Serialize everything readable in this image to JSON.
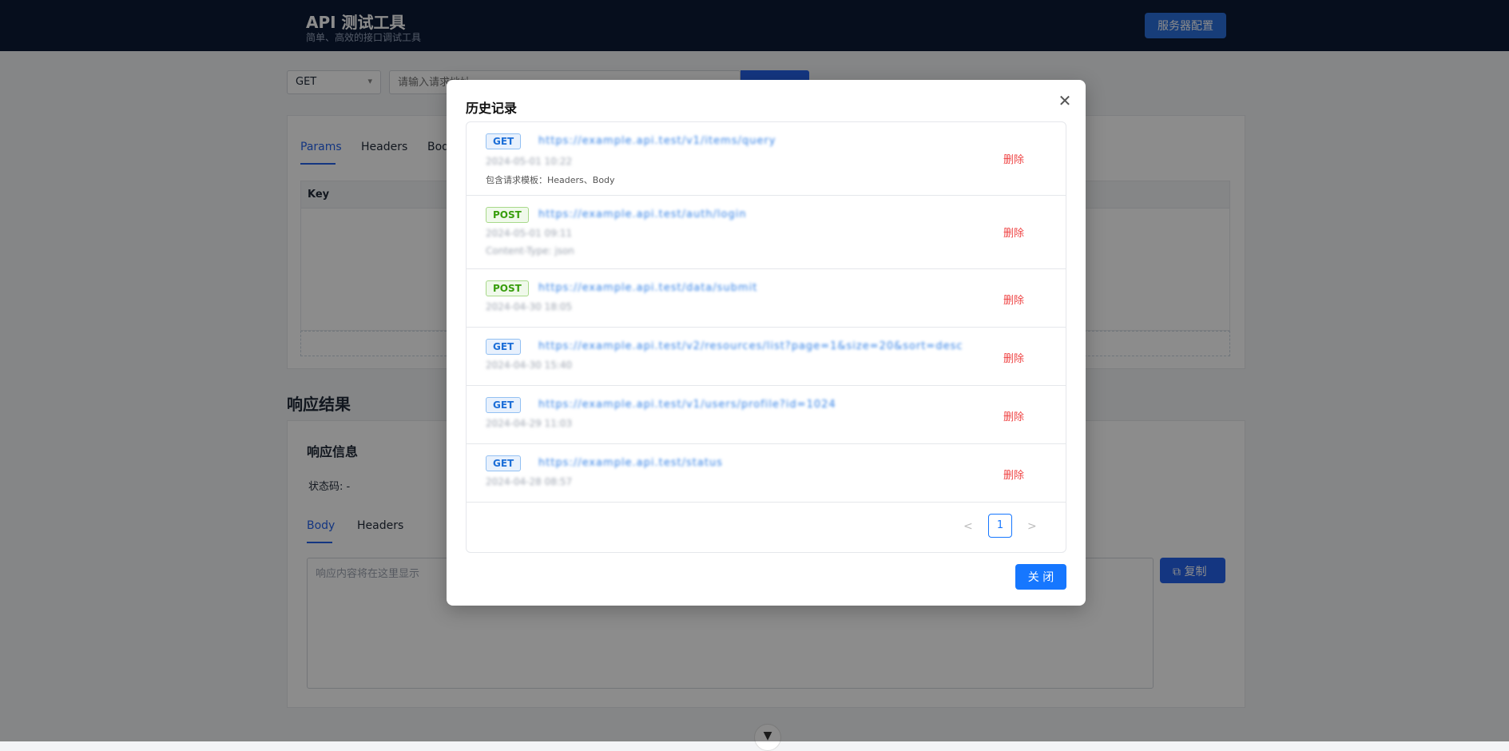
{
  "header": {
    "title": "API 测试工具",
    "subtitle": "简单、高效的接口调试工具",
    "server_config": "服务器配置"
  },
  "request": {
    "method": "GET",
    "url_placeholder": "请输入请求地址",
    "tabs": [
      "Params",
      "Headers",
      "Body"
    ],
    "table_key_header": "Key"
  },
  "response": {
    "section_title": "响应结果",
    "info_title": "响应信息",
    "status_label": "状态码: -",
    "tabs": [
      "Body",
      "Headers"
    ],
    "body_placeholder": "响应内容将在这里显示",
    "copy_label": "复制"
  },
  "modal": {
    "title": "历史记录",
    "close_label": "关 闭",
    "page_prev": "<",
    "page_current": "1",
    "page_next": ">",
    "items": [
      {
        "method": "GET",
        "url": "https://example.api.test/v1/items/query",
        "meta": "2024-05-01 10:22",
        "template": "包含请求模板：Headers、Body",
        "delete": "删除"
      },
      {
        "method": "POST",
        "url": "https://example.api.test/auth/login",
        "meta": "2024-05-01 09:11",
        "meta2": "Content-Type: json",
        "delete": "删除"
      },
      {
        "method": "POST",
        "url": "https://example.api.test/data/submit",
        "meta": "2024-04-30 18:05",
        "delete": "删除"
      },
      {
        "method": "GET",
        "url": "https://example.api.test/v2/resources/list?page=1&size=20&sort=desc",
        "meta": "2024-04-30 15:40",
        "delete": "删除"
      },
      {
        "method": "GET",
        "url": "https://example.api.test/v1/users/profile?id=1024",
        "meta": "2024-04-29 11:03",
        "delete": "删除"
      },
      {
        "method": "GET",
        "url": "https://example.api.test/status",
        "meta": "2024-04-28 08:57",
        "delete": "删除"
      }
    ]
  }
}
